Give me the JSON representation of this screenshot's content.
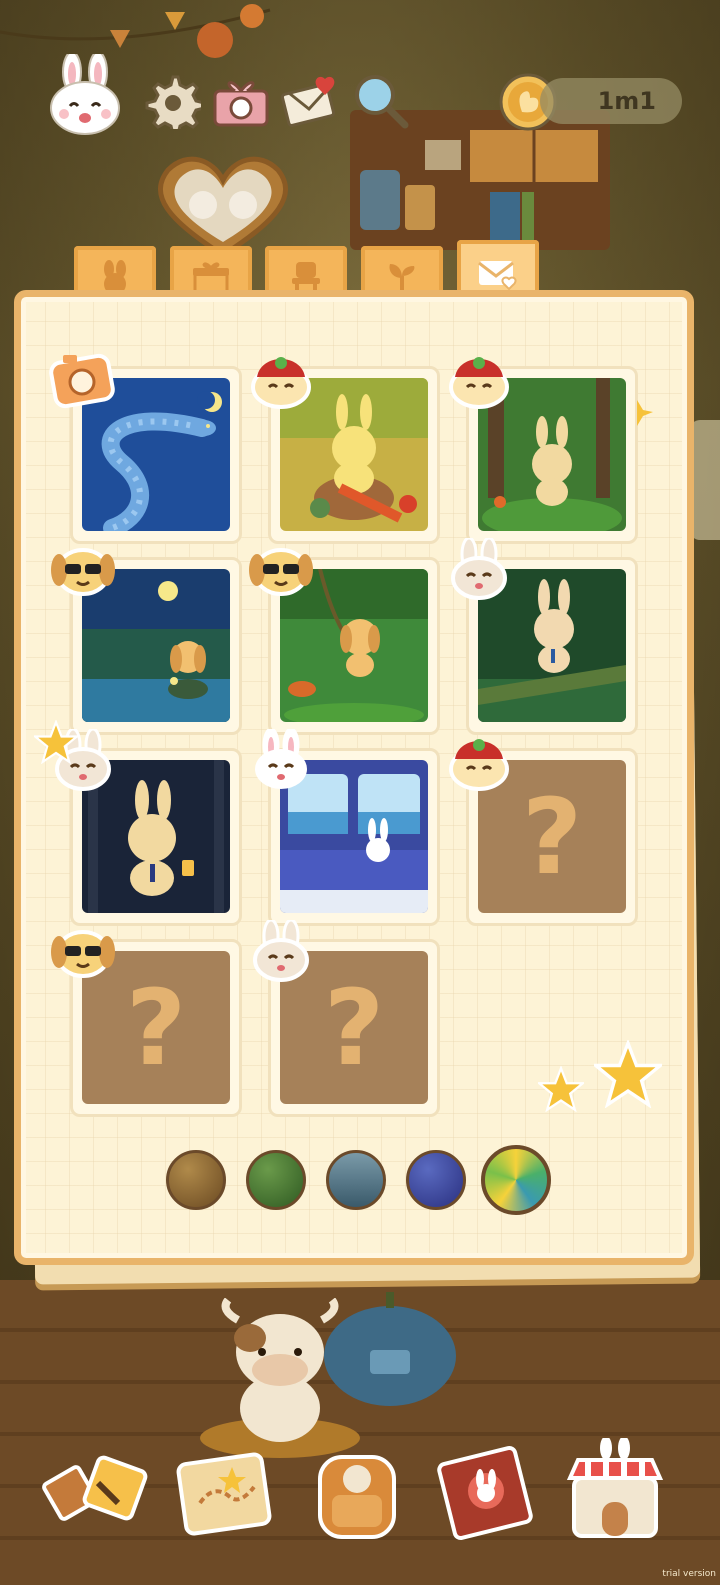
{
  "hud": {
    "icons": [
      "bunny-avatar-icon",
      "gear-icon",
      "gift-camera-icon",
      "letter-heart-icon",
      "magnifier-icon"
    ],
    "timer": "1m1"
  },
  "tabs": [
    {
      "icon": "bunny-face-icon",
      "active": false
    },
    {
      "icon": "gift-icon",
      "active": false
    },
    {
      "icon": "chair-icon",
      "active": false
    },
    {
      "icon": "sprout-icon",
      "active": false
    },
    {
      "icon": "envelope-heart-icon",
      "active": true
    }
  ],
  "album": {
    "cards": [
      {
        "scene": "blue-snake-night",
        "badge": "camera",
        "locked": false
      },
      {
        "scene": "bunny-knitting-forest",
        "badge": "hat-frog",
        "locked": false
      },
      {
        "scene": "bunny-forest-waving",
        "badge": "hat-frog",
        "locked": false
      },
      {
        "scene": "dog-lantern-lake",
        "badge": "sunglasses-dog",
        "locked": false
      },
      {
        "scene": "dog-vine-forest",
        "badge": "sunglasses-dog",
        "locked": false
      },
      {
        "scene": "bunny-log-swamp",
        "badge": "bunny",
        "locked": false
      },
      {
        "scene": "bunny-lantern-dark",
        "badge": "bunny",
        "locked": false
      },
      {
        "scene": "bunny-train-window",
        "badge": "white-bunny",
        "locked": false
      },
      {
        "scene": "locked",
        "badge": "hat-frog",
        "locked": true,
        "label": "?"
      },
      {
        "scene": "locked",
        "badge": "sunglasses-dog",
        "locked": true,
        "label": "?"
      },
      {
        "scene": "locked",
        "badge": "bunny",
        "locked": true,
        "label": "?"
      }
    ]
  },
  "orbs": [
    {
      "name": "brown-orb",
      "active": false
    },
    {
      "name": "forest-orb",
      "active": false
    },
    {
      "name": "sea-orb",
      "active": false
    },
    {
      "name": "night-orb",
      "active": false
    },
    {
      "name": "rainbow-orb",
      "active": true
    }
  ],
  "bottom_nav": [
    "tools-button",
    "map-button",
    "backpack-button",
    "bunny-book-button",
    "shop-button"
  ],
  "watermark": "trial version"
}
